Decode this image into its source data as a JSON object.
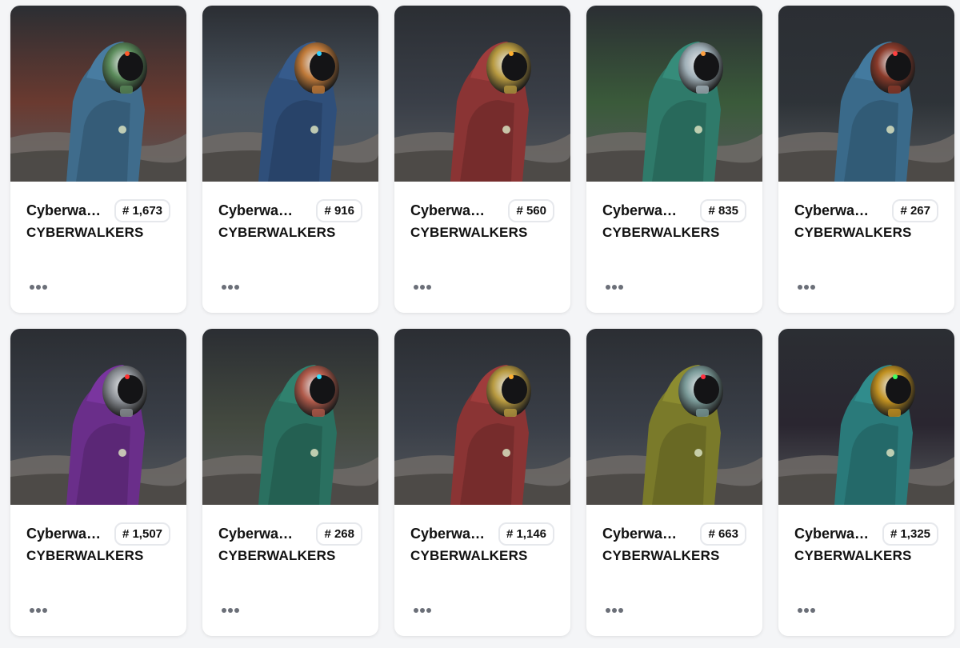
{
  "cards": [
    {
      "name": "Cyberwalker",
      "rank": "# 1,673",
      "collection": "CYBERWALKERS",
      "cloak_color": "#3f6c8c",
      "helmet_color": "#5a8a5a",
      "sky_color": "#6a3a30",
      "visor_glow": "#ff5a2a",
      "icon": "more-icon"
    },
    {
      "name": "Cyberwalker",
      "rank": "# 916",
      "collection": "CYBERWALKERS",
      "cloak_color": "#2f4f7a",
      "helmet_color": "#c07a3a",
      "sky_color": "#4a5560",
      "visor_glow": "#30d0ff",
      "icon": "more-icon"
    },
    {
      "name": "Cyberwalker",
      "rank": "# 560",
      "collection": "CYBERWALKERS",
      "cloak_color": "#8a3434",
      "helmet_color": "#b89a40",
      "sky_color": "#3a3f48",
      "visor_glow": "#ffb030",
      "icon": "more-icon"
    },
    {
      "name": "Cyberwalker",
      "rank": "# 835",
      "collection": "CYBERWALKERS",
      "cloak_color": "#2f7a6a",
      "helmet_color": "#a0b0b8",
      "sky_color": "#3a5a3a",
      "visor_glow": "#ffa040",
      "icon": "more-icon"
    },
    {
      "name": "Cyberwalker",
      "rank": "# 267",
      "collection": "CYBERWALKERS",
      "cloak_color": "#3a6a8a",
      "helmet_color": "#8a3a2a",
      "sky_color": "#2e3338",
      "visor_glow": "#ff4040",
      "icon": "more-icon"
    },
    {
      "name": "Cyberwalker",
      "rank": "# 1,507",
      "collection": "CYBERWALKERS",
      "cloak_color": "#6a2e8a",
      "helmet_color": "#8a8e94",
      "sky_color": "#3a3f48",
      "visor_glow": "#ff3030",
      "icon": "more-icon"
    },
    {
      "name": "Cyberwalker",
      "rank": "# 268",
      "collection": "CYBERWALKERS",
      "cloak_color": "#2a7060",
      "helmet_color": "#b05a4a",
      "sky_color": "#444a40",
      "visor_glow": "#30e0ff",
      "icon": "more-icon"
    },
    {
      "name": "Cyberwalker",
      "rank": "# 1,146",
      "collection": "CYBERWALKERS",
      "cloak_color": "#8a3434",
      "helmet_color": "#b89a40",
      "sky_color": "#3a3f48",
      "visor_glow": "#ffb030",
      "icon": "more-icon"
    },
    {
      "name": "Cyberwalker",
      "rank": "# 663",
      "collection": "CYBERWALKERS",
      "cloak_color": "#7a7a2a",
      "helmet_color": "#7a9a98",
      "sky_color": "#3a3f48",
      "visor_glow": "#ff3040",
      "icon": "more-icon"
    },
    {
      "name": "Cyberwalker",
      "rank": "# 1,325",
      "collection": "CYBERWALKERS",
      "cloak_color": "#2a7a7a",
      "helmet_color": "#c09020",
      "sky_color": "#2a2630",
      "visor_glow": "#40ff60",
      "icon": "more-icon"
    }
  ]
}
